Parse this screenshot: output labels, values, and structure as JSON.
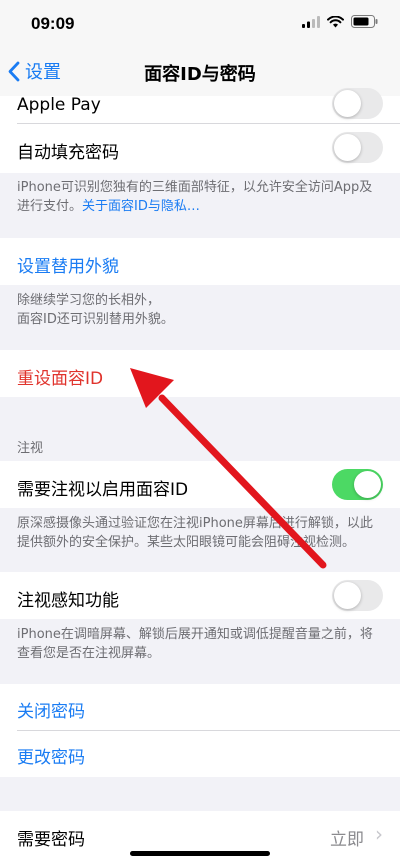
{
  "status_bar": {
    "time": "09:09"
  },
  "nav": {
    "back_label": "设置",
    "title": "面容ID与密码"
  },
  "rows": {
    "apple_pay": {
      "label": "Apple Pay",
      "enabled": false
    },
    "autofill": {
      "label": "自动填充密码",
      "enabled": false
    }
  },
  "notes": {
    "faceid_prefix": "iPhone可识别您独有的三维面部特征，以允许安全访问App及进行支付。",
    "faceid_link": "关于面容ID与隐私…",
    "alt_appearance": "除继续学习您的长相外，\n面容ID还可识别替用外貌。",
    "attention_required": "原深感摄像头通过验证您在注视iPhone屏幕后进行解锁，以此提供额外的安全保护。某些太阳眼镜可能会阻碍注视检测。",
    "attention_aware": "iPhone在调暗屏幕、解锁后展开通知或调低提醒音量之前，将查看您是否在注视屏幕。"
  },
  "actions": {
    "set_alt_appearance": "设置替用外貌",
    "reset_faceid": "重设面容ID",
    "turn_off_passcode": "关闭密码",
    "change_passcode": "更改密码"
  },
  "attention_section": {
    "header": "注视",
    "require_attention": {
      "label": "需要注视以启用面容ID",
      "enabled": true
    },
    "attention_aware": {
      "label": "注视感知功能",
      "enabled": false
    }
  },
  "require_passcode": {
    "label": "需要密码",
    "value": "立即"
  },
  "colors": {
    "accent": "#1a7cf3",
    "destructive": "#e0332c",
    "toggle_on": "#4cd964",
    "arrow": "#e2161d"
  }
}
